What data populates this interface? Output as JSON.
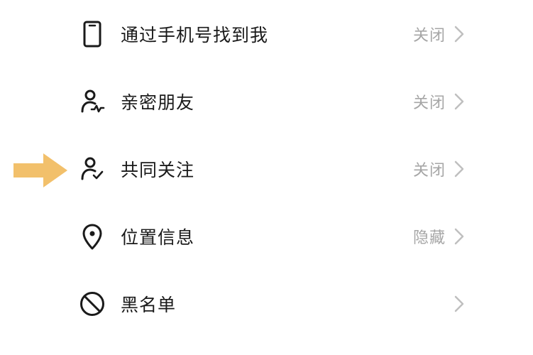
{
  "settings": {
    "items": [
      {
        "label": "通过手机号找到我",
        "value": "关闭",
        "icon": "phone-icon"
      },
      {
        "label": "亲密朋友",
        "value": "关闭",
        "icon": "close-friend-icon"
      },
      {
        "label": "共同关注",
        "value": "关闭",
        "icon": "mutual-follow-icon"
      },
      {
        "label": "位置信息",
        "value": "隐藏",
        "icon": "location-pin-icon"
      },
      {
        "label": "黑名单",
        "value": "",
        "icon": "blocked-icon"
      }
    ]
  },
  "annotation": {
    "icon": "pointer-arrow-icon",
    "color": "#f2c06b"
  },
  "colors": {
    "label": "#1a1a1a",
    "value": "#a6a6a6",
    "icon": "#1a1a1a",
    "chevron": "#bfbfbf"
  }
}
